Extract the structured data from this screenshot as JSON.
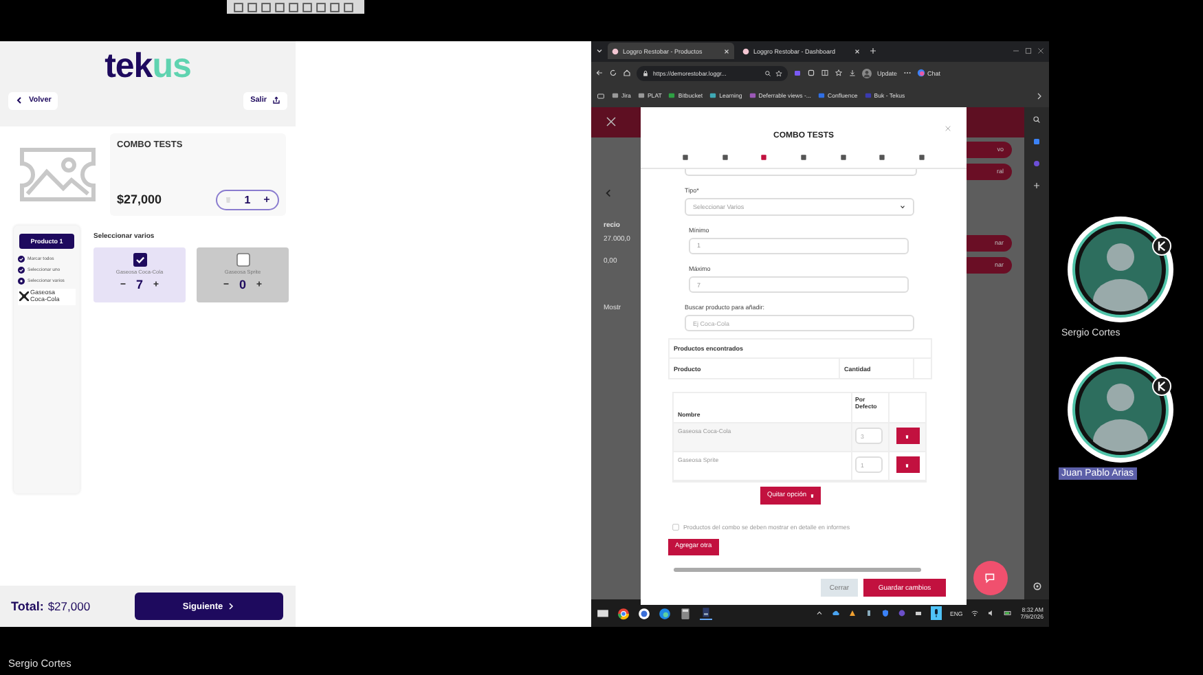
{
  "left_app": {
    "logo": {
      "part_1": "tek",
      "part_2": "us"
    },
    "back_button": "Volver",
    "exit_button": "Salir",
    "product": {
      "title": "COMBO TESTS",
      "price": "$27,000",
      "quantity": "1"
    },
    "steps": {
      "product_tab": "Producto 1",
      "items": [
        {
          "label": "Marcar todos",
          "done": true
        },
        {
          "label": "Seleccionar uno",
          "done": true
        },
        {
          "label": "Seleccionar varios",
          "done": false
        }
      ],
      "sub_item": "Gaseosa Coca-Cola"
    },
    "section_title": "Seleccionar varios",
    "options": [
      {
        "name": "Gaseosa Coca-Cola",
        "checked": true,
        "quantity": "7"
      },
      {
        "name": "Gaseosa Sprite",
        "checked": false,
        "quantity": "0"
      }
    ],
    "total_label": "Total:",
    "total": "$27,000",
    "next_button": "Siguiente"
  },
  "browser": {
    "tabs": [
      {
        "title": "Loggro Restobar - Productos",
        "selected": true
      },
      {
        "title": "Loggro Restobar - Dashboard",
        "selected": false
      }
    ],
    "address": "https://demorestobar.loggr...",
    "update_button": "Update",
    "chat_button": "Chat",
    "bookmarks": [
      "Jira",
      "PLAT",
      "Bitbucket",
      "Learning",
      "Deferrable views -...",
      "Confluence",
      "Buk - Tekus"
    ],
    "page": {
      "header_buttons": [
        "vo",
        "ral"
      ],
      "column_header": "recio",
      "cells": [
        "27.000,0",
        "0,00"
      ],
      "row_buttons": [
        "nar",
        "nar"
      ],
      "checkbox_label": "Mostr"
    },
    "modal": {
      "title": "COMBO TESTS",
      "icon_tabs": [
        {
          "selected": false
        },
        {
          "selected": false
        },
        {
          "selected": true
        },
        {
          "selected": false
        },
        {
          "selected": false
        },
        {
          "selected": false
        },
        {
          "selected": false
        }
      ],
      "fields": [
        {
          "kind": "select",
          "label": "Tipo*",
          "value": "Seleccionar Varios"
        },
        {
          "kind": "number",
          "label": "Mínimo",
          "value": "1"
        },
        {
          "kind": "number",
          "label": "Máximo",
          "value": "7"
        },
        {
          "kind": "search",
          "label": "Buscar producto para añadir:",
          "placeholder": "Ej Coca-Cola"
        }
      ],
      "found_products": {
        "title": "Productos encontrados",
        "columns": [
          "Producto",
          "Cantidad"
        ]
      },
      "options_table": {
        "columns": [
          "Nombre",
          "Por Defecto"
        ],
        "rows": [
          {
            "name": "Gaseosa Coca-Cola",
            "default": "3"
          },
          {
            "name": "Gaseosa Sprite",
            "default": "1"
          }
        ]
      },
      "remove_option_button": "Quitar opción",
      "detail_checkbox": {
        "label": "Productos del combo se deben mostrar en detalle en informes",
        "checked": false
      },
      "add_button": "Agregar otra",
      "close_button": "Cerrar",
      "save_button": "Guardar cambios"
    },
    "taskbar": {
      "language": "ENG",
      "time": "8:32 AM",
      "date": "7/9/2026"
    }
  },
  "participants": [
    {
      "name": "Sergio Cortes",
      "highlighted": false
    },
    {
      "name": "Juan Pablo Arias",
      "highlighted": true
    }
  ],
  "presenter_name": "Sergio Cortes"
}
